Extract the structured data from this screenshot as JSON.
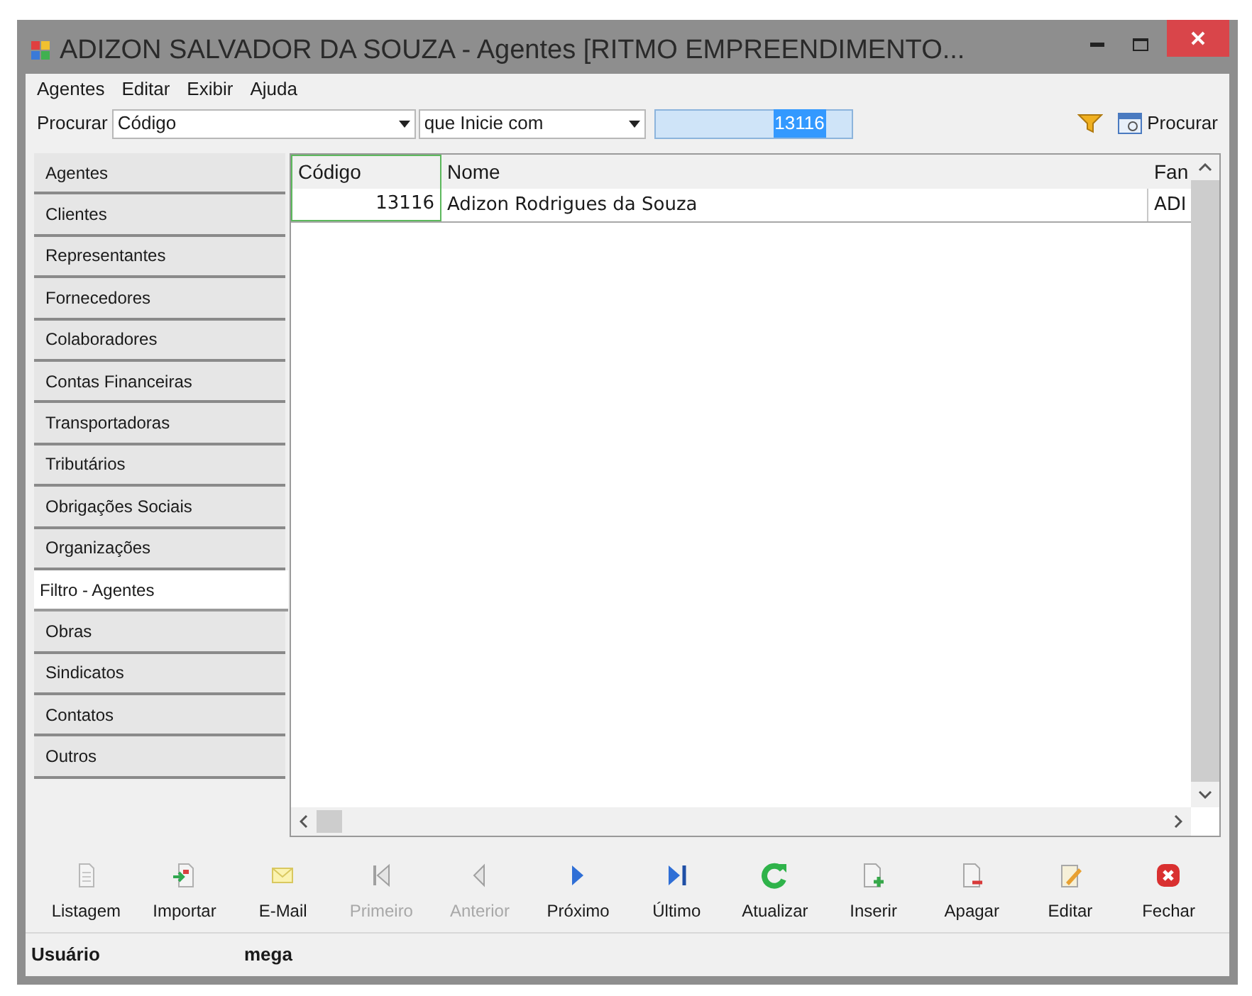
{
  "window": {
    "title": "ADIZON SALVADOR DA SOUZA  -  Agentes [RITMO EMPREENDIMENTO..."
  },
  "menu": [
    "Agentes",
    "Editar",
    "Exibir",
    "Ajuda"
  ],
  "search": {
    "label": "Procurar",
    "field": "Código",
    "condition": "que Inicie com",
    "value": "13116",
    "button": "Procurar"
  },
  "sidebar": {
    "items": [
      {
        "label": "Agentes",
        "selected": false
      },
      {
        "label": "Clientes",
        "selected": false
      },
      {
        "label": "Representantes",
        "selected": false
      },
      {
        "label": "Fornecedores",
        "selected": false
      },
      {
        "label": "Colaboradores",
        "selected": false
      },
      {
        "label": "Contas Financeiras",
        "selected": false
      },
      {
        "label": "Transportadoras",
        "selected": false
      },
      {
        "label": "Tributários",
        "selected": false
      },
      {
        "label": "Obrigações Sociais",
        "selected": false
      },
      {
        "label": "Organizações",
        "selected": false
      },
      {
        "label": "Filtro - Agentes",
        "selected": true
      },
      {
        "label": "Obras",
        "selected": false
      },
      {
        "label": "Sindicatos",
        "selected": false
      },
      {
        "label": "Contatos",
        "selected": false
      },
      {
        "label": "Outros",
        "selected": false
      }
    ]
  },
  "table": {
    "columns": [
      "Código",
      "Nome",
      "Fan"
    ],
    "rows": [
      [
        "13116",
        "Adizon Rodrigues da Souza",
        "ADI"
      ]
    ]
  },
  "toolbar": [
    {
      "label": "Listagem",
      "kind": "list",
      "disabled": false
    },
    {
      "label": "Importar",
      "kind": "import",
      "disabled": false
    },
    {
      "label": "E-Mail",
      "kind": "mail",
      "disabled": false
    },
    {
      "label": "Primeiro",
      "kind": "first",
      "disabled": true
    },
    {
      "label": "Anterior",
      "kind": "prev",
      "disabled": true
    },
    {
      "label": "Próximo",
      "kind": "next",
      "disabled": false
    },
    {
      "label": "Último",
      "kind": "last",
      "disabled": false
    },
    {
      "label": "Atualizar",
      "kind": "refresh",
      "disabled": false
    },
    {
      "label": "Inserir",
      "kind": "insert",
      "disabled": false
    },
    {
      "label": "Apagar",
      "kind": "delete",
      "disabled": false
    },
    {
      "label": "Editar",
      "kind": "edit",
      "disabled": false
    },
    {
      "label": "Fechar",
      "kind": "close",
      "disabled": false
    }
  ],
  "status_bar": {
    "label": "Usuário",
    "value": "mega"
  }
}
